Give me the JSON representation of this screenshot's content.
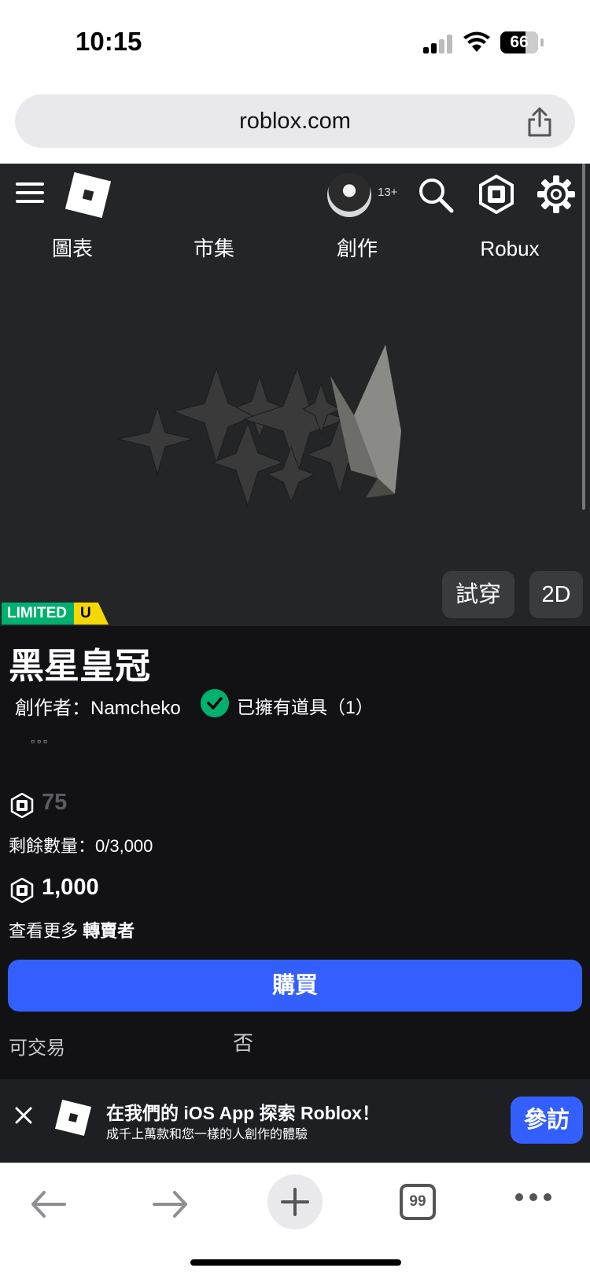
{
  "status_bar": {
    "time": "10:15",
    "battery": "66",
    "battery_level": 0.66
  },
  "browser": {
    "url": "roblox.com"
  },
  "header": {
    "age_badge": "13+",
    "nav_tabs": [
      "圖表",
      "市集",
      "創作",
      "Robux"
    ]
  },
  "item": {
    "badge_limited": "LIMITED",
    "badge_u": "U",
    "try_on_label": "試穿",
    "view_2d_label": "2D",
    "title": "黑星皇冠",
    "creator": "創作者：Namcheko",
    "owned": "已擁有道具（1）",
    "more_menu": "▫▫▫",
    "original_price": "75",
    "remaining": "剩餘數量：0/3,000",
    "current_price": "1,000",
    "see_more_prefix": "查看更多 ",
    "see_more_link": "轉賣者",
    "buy_label": "購買",
    "tradable_label": "可交易",
    "tradable_value": "否"
  },
  "app_banner": {
    "title": "在我們的 iOS App 探索 Roblox！",
    "subtitle": "成千上萬款和您一樣的人創作的體驗",
    "visit_label": "參訪"
  },
  "toolbar": {
    "tabs_count": "99"
  },
  "colors": {
    "accent_blue": "#335fff",
    "limited_green": "#00b06f",
    "limited_yellow": "#f5d800",
    "header_bg": "#232527",
    "details_bg": "#121215"
  },
  "icons": [
    "menu-icon",
    "roblox-logo",
    "search-icon",
    "robux-icon",
    "gear-icon",
    "share-icon",
    "check-icon",
    "close-icon",
    "back-icon",
    "forward-icon",
    "plus-icon",
    "tabs-icon",
    "more-icon"
  ]
}
